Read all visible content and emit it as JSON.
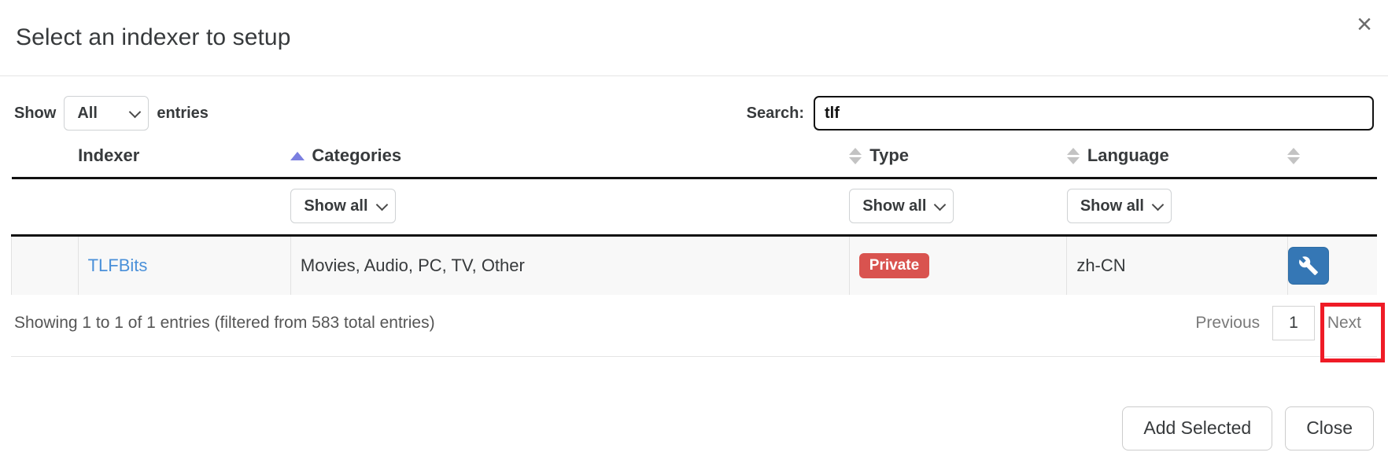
{
  "modal": {
    "title": "Select an indexer to setup",
    "close_icon_label": "×"
  },
  "controls": {
    "length_label_pre": "Show",
    "length_value": "All",
    "length_label_post": "entries",
    "search_label": "Search:",
    "search_value": "tlf",
    "search_placeholder": ""
  },
  "table": {
    "headers": {
      "checkbox": "",
      "indexer": "Indexer",
      "categories": "Categories",
      "type": "Type",
      "language": "Language",
      "action": ""
    },
    "filters": {
      "categories": "Show all",
      "type": "Show all",
      "language": "Show all"
    },
    "rows": [
      {
        "indexer": "TLFBits",
        "categories": "Movies, Audio, PC, TV, Other",
        "type": "Private",
        "type_color": "#d9534f",
        "language": "zh-CN",
        "action_icon": "wrench-icon"
      }
    ]
  },
  "footer": {
    "showing_info": "Showing 1 to 1 of 1 entries (filtered from 583 total entries)",
    "pagination": {
      "previous": "Previous",
      "pages": [
        "1"
      ],
      "next": "Next"
    },
    "add_selected": "Add Selected",
    "close": "Close"
  },
  "colors": {
    "link": "#4a90d9",
    "badge_private": "#d9534f",
    "action_button": "#3577b5",
    "sort_active": "#7b7fe0",
    "highlight": "#ef1b26"
  }
}
